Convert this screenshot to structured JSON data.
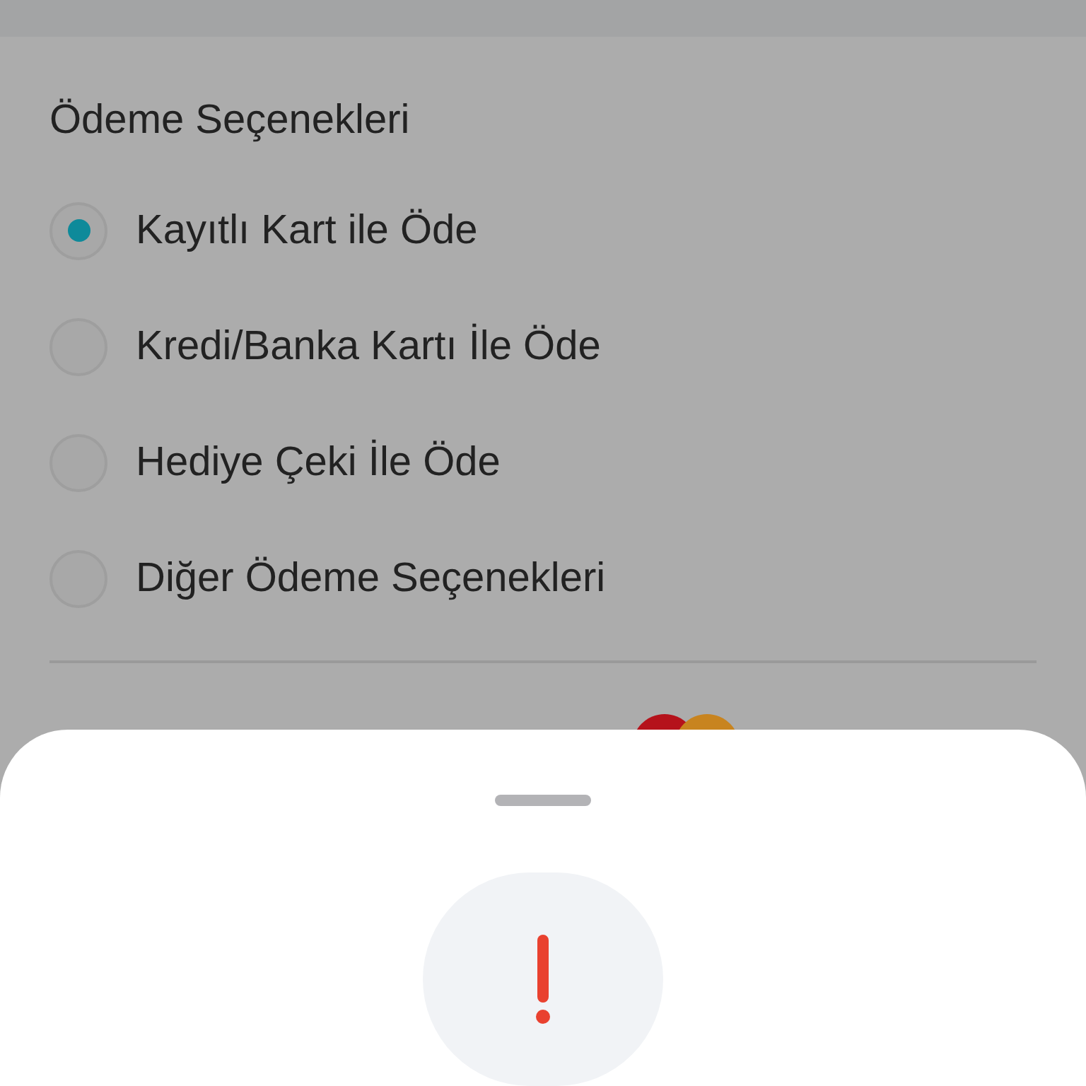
{
  "payment_options": {
    "title": "Ödeme Seçenekleri",
    "options": [
      {
        "label": "Kayıtlı Kart ile Öde",
        "selected": true
      },
      {
        "label": "Kredi/Banka Kartı İle Öde",
        "selected": false
      },
      {
        "label": "Hediye Çeki İle Öde",
        "selected": false
      },
      {
        "label": "Diğer Ödeme Seçenekleri",
        "selected": false
      }
    ]
  }
}
